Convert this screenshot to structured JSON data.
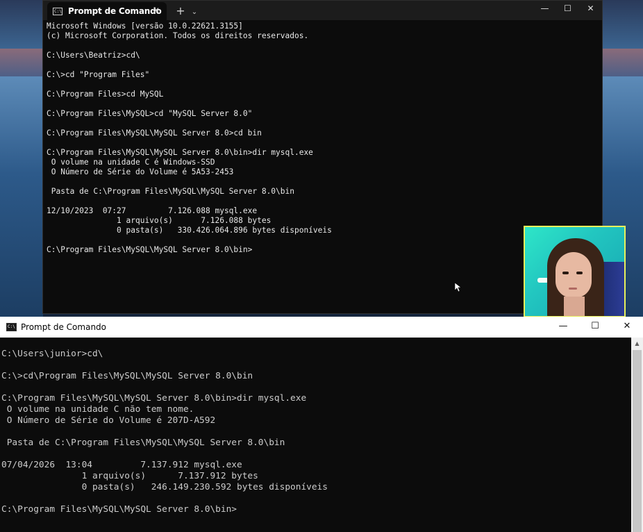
{
  "top_terminal": {
    "tab_title": "Prompt de Comando",
    "tab_icon": "C:\\",
    "tab_close": "✕",
    "new_tab": "+",
    "dropdown": "⌄",
    "window_buttons": {
      "minimize": "—",
      "maximize": "☐",
      "close": "✕"
    },
    "lines": [
      "Microsoft Windows [versão 10.0.22621.3155]",
      "(c) Microsoft Corporation. Todos os direitos reservados.",
      "",
      "C:\\Users\\Beatriz>cd\\",
      "",
      "C:\\>cd \"Program Files\"",
      "",
      "C:\\Program Files>cd MySQL",
      "",
      "C:\\Program Files\\MySQL>cd \"MySQL Server 8.0\"",
      "",
      "C:\\Program Files\\MySQL\\MySQL Server 8.0>cd bin",
      "",
      "C:\\Program Files\\MySQL\\MySQL Server 8.0\\bin>dir mysql.exe",
      " O volume na unidade C é Windows-SSD",
      " O Número de Série do Volume é 5A53-2453",
      "",
      " Pasta de C:\\Program Files\\MySQL\\MySQL Server 8.0\\bin",
      "",
      "12/10/2023  07:27         7.126.088 mysql.exe",
      "               1 arquivo(s)      7.126.088 bytes",
      "               0 pasta(s)   330.426.064.896 bytes disponíveis",
      "",
      "C:\\Program Files\\MySQL\\MySQL Server 8.0\\bin>"
    ]
  },
  "bottom_console": {
    "title": "Prompt de Comando",
    "icon": "C:\\",
    "window_buttons": {
      "minimize": "—",
      "maximize": "☐",
      "close": "✕"
    },
    "scroll_up": "▲",
    "lines": [
      "C:\\Users\\junior>cd\\",
      "",
      "C:\\>cd\\Program Files\\MySQL\\MySQL Server 8.0\\bin",
      "",
      "C:\\Program Files\\MySQL\\MySQL Server 8.0\\bin>dir mysql.exe",
      " O volume na unidade C não tem nome.",
      " O Número de Série do Volume é 207D-A592",
      "",
      " Pasta de C:\\Program Files\\MySQL\\MySQL Server 8.0\\bin",
      "",
      "07/04/2026  13:04         7.137.912 mysql.exe",
      "               1 arquivo(s)      7.137.912 bytes",
      "               0 pasta(s)   246.149.230.592 bytes disponíveis",
      "",
      "C:\\Program Files\\MySQL\\MySQL Server 8.0\\bin>"
    ]
  }
}
